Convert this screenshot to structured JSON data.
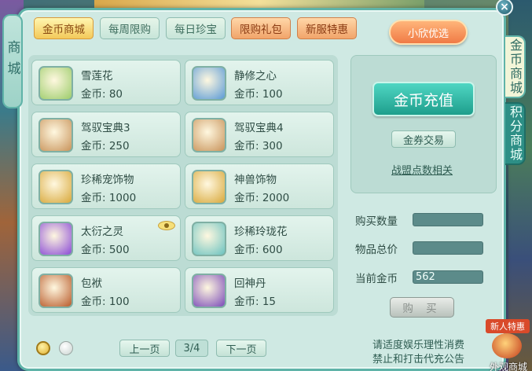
{
  "side": {
    "left_tab": "商城",
    "right_tabs": [
      "金币商城",
      "积分商城"
    ]
  },
  "tabs": [
    {
      "label": "金币商城",
      "state": "active"
    },
    {
      "label": "每周限购",
      "state": "normal"
    },
    {
      "label": "每日珍宝",
      "state": "normal"
    },
    {
      "label": "限购礼包",
      "state": "orange"
    },
    {
      "label": "新服特惠",
      "state": "orange"
    }
  ],
  "featured_button": "小欣优选",
  "items": [
    {
      "name": "雪莲花",
      "price": "金币: 80",
      "icon": "lotus-icon",
      "color": "#9ccc6a"
    },
    {
      "name": "静修之心",
      "price": "金币: 100",
      "icon": "heart-crystal-icon",
      "color": "#5a9ad6"
    },
    {
      "name": "驾驭宝典3",
      "price": "金币: 250",
      "icon": "book-icon",
      "color": "#c8935a"
    },
    {
      "name": "驾驭宝典4",
      "price": "金币: 300",
      "icon": "book-icon",
      "color": "#c8935a"
    },
    {
      "name": "珍稀宠饰物",
      "price": "金币: 1000",
      "icon": "golden-ornament-icon",
      "color": "#d8a83a"
    },
    {
      "name": "神兽饰物",
      "price": "金币: 2000",
      "icon": "golden-ornament-icon",
      "color": "#d8a83a"
    },
    {
      "name": "太衍之灵",
      "price": "金币: 500",
      "icon": "purple-orb-icon",
      "color": "#8a4ad6"
    },
    {
      "name": "珍稀玲珑花",
      "price": "金币: 600",
      "icon": "crystal-flower-icon",
      "color": "#6ac2c0"
    },
    {
      "name": "包袱",
      "price": "金币: 100",
      "icon": "pouch-icon",
      "color": "#b85a2a"
    },
    {
      "name": "回神丹",
      "price": "金币: 15",
      "icon": "pill-icon",
      "color": "#7a4ab8"
    }
  ],
  "right_panel": {
    "recharge": "金币充值",
    "trade": "金券交易",
    "alliance": "战盟点数相关",
    "qty_label": "购买数量",
    "total_label": "物品总价",
    "gold_label": "当前金币",
    "gold_value": "562",
    "buy": "购 买"
  },
  "pagination": {
    "prev": "上一页",
    "page": "3/4",
    "next": "下一页"
  },
  "notice": [
    "请适度娱乐理性消费",
    "禁止和打击代充公告"
  ],
  "newbie": {
    "tag": "新人特惠",
    "label": "外观商城"
  }
}
